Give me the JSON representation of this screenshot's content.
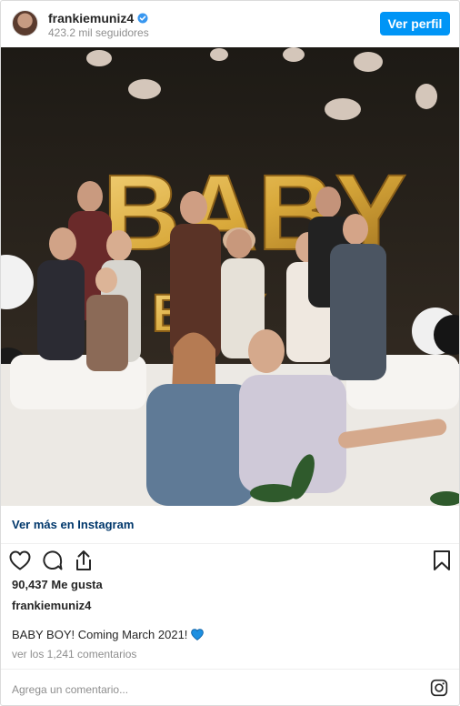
{
  "header": {
    "username": "frankiemuniz4",
    "followers": "423.2 mil seguidores",
    "view_profile_label": "Ver perfil"
  },
  "photo": {
    "balloons_large": "BABY",
    "balloons_small": "BOY"
  },
  "more_link": "Ver más en Instagram",
  "likes": {
    "count": "90,437",
    "label": "Me gusta"
  },
  "post_author": "frankiemuniz4",
  "caption": "BABY BOY! Coming March 2021!",
  "comments_link": "ver los 1,241 comentarios",
  "comment_placeholder": "Agrega un comentario...",
  "icons": {
    "like": "heart-outline-icon",
    "comment": "comment-bubble-icon",
    "share": "share-icon",
    "save": "bookmark-icon",
    "caption_emoji": "blue-heart-icon",
    "brand": "instagram-logo-icon",
    "verified": "verified-badge-icon"
  },
  "colors": {
    "accent_blue": "#0095f6",
    "link_blue": "#00376b",
    "muted": "#8e8e8e",
    "gold_balloon": "#d9a93b"
  }
}
